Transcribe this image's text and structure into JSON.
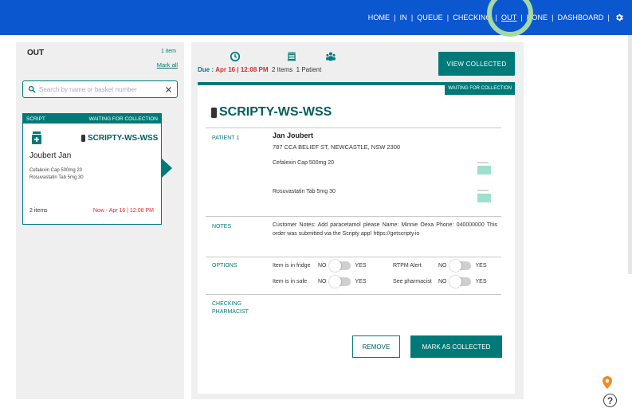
{
  "nav": {
    "items": [
      "HOME",
      "IN",
      "QUEUE",
      "CHECKING",
      "OUT",
      "DONE",
      "DASHBOARD"
    ],
    "active": "OUT",
    "settings_icon": "gear-icon"
  },
  "left": {
    "title": "OUT",
    "count": "1 item",
    "mark_all": "Mark all",
    "search": {
      "placeholder": "Search by name or basket number",
      "value": ""
    },
    "card": {
      "type": "SCRIPT",
      "status": "WAITING FOR COLLECTION",
      "code": "SCRIPTY-WS-WSS",
      "name": "Joubert Jan",
      "meds": [
        "Cefalexin Cap 500mg 20",
        "Rosuvastatin Tab 5mg 30"
      ],
      "items": "2 items",
      "due": "Now - Apr 16 | 12:08 PM"
    }
  },
  "main": {
    "due_label": "Due :",
    "due_time": "Apr 16 | 12:08 PM",
    "items": "2 Items",
    "patients": "1 Patient",
    "view_collected": "VIEW COLLECTED",
    "status": "WAITING FOR COLLECTION",
    "code": "SCRIPTY-WS-WSS",
    "patient_label": "PATIENT 1",
    "patient_name": "Jan Joubert",
    "patient_address": "787 CCA BELIEF ST, NEWCASTLE, NSW 2300",
    "meds": [
      "Cefalexin Cap 500mg 20",
      "Rosuvastatin Tab 5mg 30"
    ],
    "notes_label": "NOTES",
    "notes": "Customer Notes: Add paracetamol please Name: Minnie Oexa Phone: 040000000 This order was submitted via the Scripty app! https://getscripty.io",
    "options_label": "OPTIONS",
    "options": [
      {
        "label": "Item is in fridge",
        "no": "NO",
        "yes": "YES"
      },
      {
        "label": "RTPM Alert",
        "no": "NO",
        "yes": "YES"
      },
      {
        "label": "Item is in safe",
        "no": "NO",
        "yes": "YES"
      },
      {
        "label": "See pharmacist",
        "no": "NO",
        "yes": "YES"
      }
    ],
    "checking_label": "CHECKING PHARMACIST",
    "remove": "REMOVE",
    "mark_collected": "MARK AS COLLECTED"
  },
  "colors": {
    "nav": "#0b57d0",
    "teal": "#007a78",
    "due_red": "#d32f2f",
    "highlight_ring": "#a6d8a3"
  }
}
